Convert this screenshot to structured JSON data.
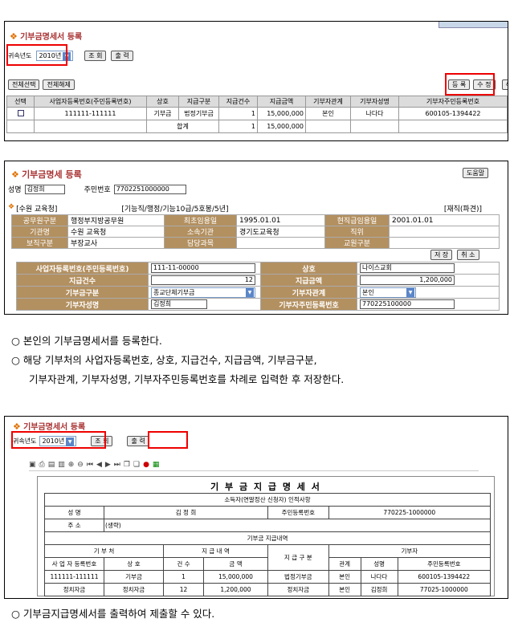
{
  "panel1": {
    "title": "기부금명세서 등록",
    "year_label": "귀속년도",
    "year_value": "2010년",
    "query_btn": "조 회",
    "print_btn": "출 력",
    "select_all": "전체선택",
    "deselect_all": "전체해제",
    "reg_btn": "등 록",
    "edit_btn": "수 정",
    "del_btn": "삭",
    "headers": [
      "선택",
      "사업자등록번호(주민등록번호)",
      "상호",
      "지급구분",
      "지급건수",
      "지급금액",
      "기부자관계",
      "기부자성명",
      "기부자주민등록번호"
    ],
    "row": {
      "bizno": "111111-111111",
      "name": "기부금",
      "type": "법정기부금",
      "count": "1",
      "amount": "15,000,000",
      "rel": "본인",
      "donor": "나다다",
      "donorid": "600105-1394422"
    },
    "sum": {
      "label": "합계",
      "count": "1",
      "amount": "15,000,000"
    }
  },
  "panel2": {
    "title": "기부금명세 등록",
    "help_btn": "도움말",
    "name_label": "성명",
    "name_value": "김정희",
    "id_label": "주민번호",
    "id_value": "7702251000000",
    "school": "[수원 교육청]",
    "grade": "[기능직/행정/기능10급/5호봉/5년]",
    "status": "[재직(파견)]",
    "info": [
      [
        "공무원구분",
        "행정부지방공무원",
        "최초임용일",
        "1995.01.01",
        "현직급임용일",
        "2001.01.01"
      ],
      [
        "기관명",
        "수원 교육청",
        "소속기관",
        "경기도교육청",
        "직위",
        ""
      ],
      [
        "보직구분",
        "부장교사",
        "담당과목",
        "",
        "교원구분",
        ""
      ]
    ],
    "save_btn": "저 장",
    "cancel_btn": "취 소",
    "form": {
      "biz_label": "사업자등록번호(주민등록번호)",
      "biz_value": "111-11-00000",
      "trade_label": "상호",
      "trade_value": "나이스교회",
      "count_label": "지급건수",
      "count_value": "12",
      "amount_label": "지급금액",
      "amount_value": "1,200,000",
      "type_label": "기부금구분",
      "type_value": "종교단체기부금",
      "rel_label": "기부자관계",
      "rel_value": "본인",
      "dname_label": "기부자성명",
      "dname_value": "김정희",
      "did_label": "기부자주민등록번호",
      "did_value": "770225100000"
    }
  },
  "desc1": {
    "bullet": "○",
    "line1": "본인의 기부금명세서를 등록한다.",
    "line2": "해당 기부처의 사업자등록번호, 상호, 지급건수, 지급금액, 기부금구분,",
    "line3": "기부자관계, 기부자성명, 기부자주민등록번호를 차례로 입력한 후 저장한다."
  },
  "panel3": {
    "title": "기부금명세서 등록",
    "year_label": "귀속년도",
    "year_value": "2010년",
    "query_btn": "조 회",
    "print_btn": "출 력",
    "report": {
      "title": "기 부 금 지 급 명 세 서",
      "subtitle": "소득자(연말정산 신청자) 인적사항",
      "name_label": "성 명",
      "name_value": "김 정 희",
      "id_label": "주민등록번호",
      "id_value": "770225-1000000",
      "addr_label": "주 소",
      "addr_value": "(생략)",
      "detail": "기부금 지급내역",
      "giver": "기 부 처",
      "paydetail": "지 급 내 역",
      "kind": "지 급 구 분",
      "donor": "기부자",
      "biz": "사 업 자 등록번호",
      "trade": "상 호",
      "cnt": "건 수",
      "amt": "금 액",
      "rel": "관계",
      "dname": "성명",
      "did": "주민등록번호",
      "rows": [
        [
          "111111-111111",
          "기부금",
          "1",
          "15,000,000",
          "법정기부금",
          "본인",
          "나다다",
          "600105-1394422"
        ],
        [
          "정치자금",
          "정치자금",
          "12",
          "1,200,000",
          "정치자금",
          "본인",
          "김정희",
          "77025-1000000"
        ]
      ]
    }
  },
  "desc2": {
    "bullet": "○",
    "line1": "기부금지급명세서를 출력하여 제출할 수 있다."
  }
}
